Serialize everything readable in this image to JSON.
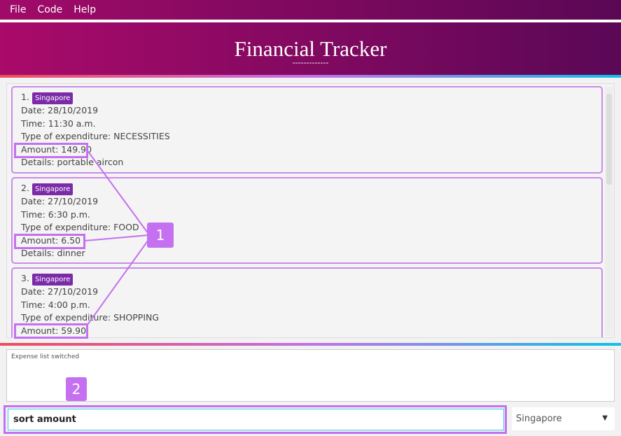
{
  "menu": [
    "File",
    "Code",
    "Help"
  ],
  "header": {
    "title": "Financial Tracker",
    "underline": "-------------"
  },
  "expenses": [
    {
      "index": "1.",
      "tag": "Singapore",
      "date": "Date: 28/10/2019",
      "time": "Time: 11:30 a.m.",
      "type": "Type of expenditure: NECESSITIES",
      "amount": "Amount: 149.90",
      "details": "Details: portable aircon"
    },
    {
      "index": "2.",
      "tag": "Singapore",
      "date": "Date: 27/10/2019",
      "time": "Time: 6:30 p.m.",
      "type": "Type of expenditure: FOOD",
      "amount": "Amount: 6.50",
      "details": "Details: dinner"
    },
    {
      "index": "3.",
      "tag": "Singapore",
      "date": "Date: 27/10/2019",
      "time": "Time: 4:00 p.m.",
      "type": "Type of expenditure: SHOPPING",
      "amount": "Amount: 59.90",
      "details": ""
    }
  ],
  "result": "Expense list switched",
  "command": {
    "value": "sort amount"
  },
  "country_select": {
    "selected": "Singapore"
  },
  "annotations": {
    "label1": "1",
    "label2": "2"
  },
  "colors": {
    "accent": "#c570f0",
    "tag": "#7b2aa8",
    "header_start": "#aa0a6a",
    "header_end": "#5a0857"
  }
}
